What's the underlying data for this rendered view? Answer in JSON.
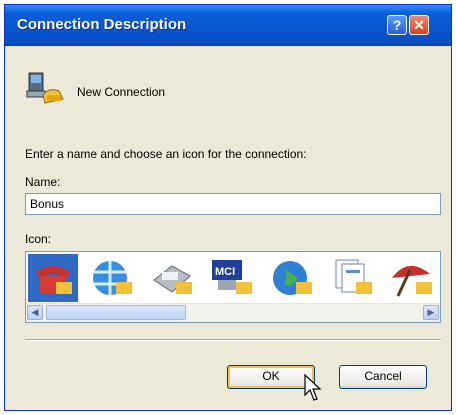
{
  "window": {
    "title": "Connection Description"
  },
  "title_buttons": {
    "help": "?",
    "close": "✕"
  },
  "connection": {
    "name": "New Connection",
    "icon": "phone-connection-icon"
  },
  "form": {
    "prompt": "Enter a name and choose an icon for the connection:",
    "name_label": "Name:",
    "name_value": "Bonus",
    "icon_label": "Icon:"
  },
  "icons": [
    {
      "name": "red-telephone-icon",
      "selected": true
    },
    {
      "name": "globe-icon",
      "selected": false
    },
    {
      "name": "fax-machine-icon",
      "selected": false
    },
    {
      "name": "mci-icon",
      "selected": false
    },
    {
      "name": "world-network-icon",
      "selected": false
    },
    {
      "name": "documents-icon",
      "selected": false
    },
    {
      "name": "umbrella-icon",
      "selected": false
    }
  ],
  "buttons": {
    "ok": "OK",
    "cancel": "Cancel"
  },
  "colors": {
    "title_bar": "#0856d0",
    "selection": "#316ac5",
    "dialog_bg": "#ece9d8"
  }
}
